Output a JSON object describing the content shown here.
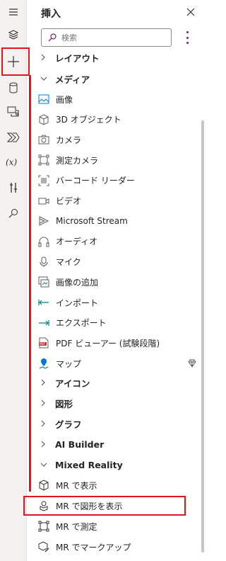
{
  "panel": {
    "title": "挿入",
    "search_placeholder": "検索"
  },
  "rail": {
    "icons": [
      "hamburger-icon",
      "layers-icon",
      "plus-icon",
      "database-icon",
      "media-icon",
      "power-automate-icon",
      "variables-icon",
      "tools-icon",
      "search-icon"
    ]
  },
  "list": {
    "top_partial": "レイアウト",
    "media_header": "メディア",
    "media_items": [
      {
        "label": "画像",
        "icon": "image-icon"
      },
      {
        "label": "3D オブジェクト",
        "icon": "cube-icon"
      },
      {
        "label": "カメラ",
        "icon": "camera-icon"
      },
      {
        "label": "測定カメラ",
        "icon": "measure-camera-icon"
      },
      {
        "label": "バーコード リーダー",
        "icon": "barcode-icon"
      },
      {
        "label": "ビデオ",
        "icon": "video-icon"
      },
      {
        "label": "Microsoft Stream",
        "icon": "stream-icon"
      },
      {
        "label": "オーディオ",
        "icon": "headphones-icon"
      },
      {
        "label": "マイク",
        "icon": "microphone-icon"
      },
      {
        "label": "画像の追加",
        "icon": "add-image-icon"
      },
      {
        "label": "インポート",
        "icon": "import-icon"
      },
      {
        "label": "エクスポート",
        "icon": "export-icon"
      },
      {
        "label": "PDF ビューアー (試験段階)",
        "icon": "pdf-icon"
      },
      {
        "label": "マップ",
        "icon": "map-icon",
        "premium": true
      }
    ],
    "collapsed": [
      "アイコン",
      "図形",
      "グラフ",
      "AI Builder"
    ],
    "mr_header": "Mixed Reality",
    "mr_items": [
      {
        "label": "MR で表示",
        "icon": "mr-view-icon"
      },
      {
        "label": "MR で図形を表示",
        "icon": "mr-shape-icon"
      },
      {
        "label": "MR で測定",
        "icon": "mr-measure-icon"
      },
      {
        "label": "MR でマークアップ",
        "icon": "mr-markup-icon"
      }
    ]
  },
  "colors": {
    "accent": "#742774",
    "highlight": "#e3141e",
    "rail_bg": "#f3f2f1"
  }
}
